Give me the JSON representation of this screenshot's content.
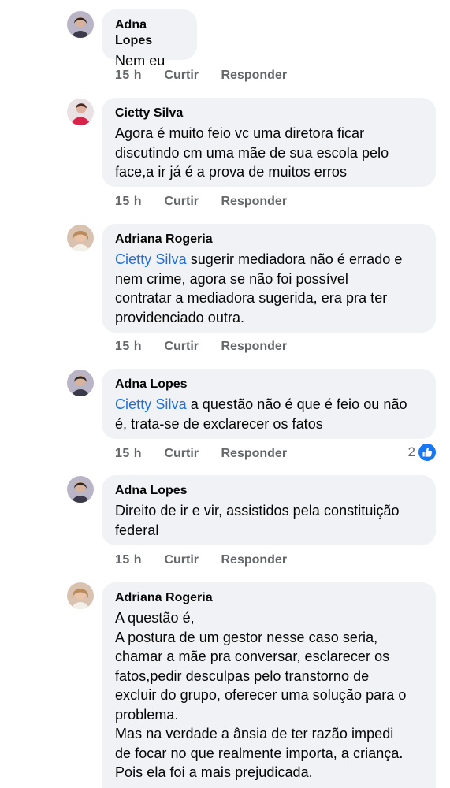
{
  "comments": [
    {
      "author": "Adna Lopes",
      "lines": [
        "Nem eu"
      ],
      "time": "15 h",
      "like_label": "Curtir",
      "reply_label": "Responder"
    },
    {
      "author": "Cietty Silva",
      "lines": [
        "Agora é muito feio vc uma diretora ficar",
        "discutindo cm uma mãe de sua escola pelo",
        "face,a ir já é a prova de muitos erros"
      ],
      "time": "15 h",
      "like_label": "Curtir",
      "reply_label": "Responder"
    },
    {
      "author": "Adriana Rogeria",
      "mention": "Cietty Silva",
      "lines": [
        " sugerir mediadora não é errado e",
        "nem crime, agora se não foi possível",
        "contratar a mediadora sugerida, era pra ter",
        "providenciado outra."
      ],
      "time": "15 h",
      "like_label": "Curtir",
      "reply_label": "Responder"
    },
    {
      "author": "Adna Lopes",
      "mention": "Cietty Silva",
      "lines": [
        " a questão não é que é feio ou não",
        "é, trata-se de exclarecer os fatos"
      ],
      "time": "15 h",
      "like_label": "Curtir",
      "reply_label": "Responder",
      "reaction_count": "2"
    },
    {
      "author": "Adna Lopes",
      "lines": [
        "Direito de ir e vir, assistidos pela constituição",
        "federal"
      ],
      "time": "15 h",
      "like_label": "Curtir",
      "reply_label": "Responder"
    },
    {
      "author": "Adriana Rogeria",
      "lines": [
        "A questão é,",
        "A postura de um gestor nesse caso seria,",
        "chamar a mãe pra conversar, esclarecer os",
        "fatos,pedir desculpas pelo transtorno de",
        "excluir do grupo, oferecer uma solução para o",
        "problema.",
        "Mas na verdade a ânsia de ter razão impedi",
        "de focar no que realmente importa, a criança.",
        "Pois ela foi a mais prejudicada."
      ]
    }
  ],
  "colors": {
    "bubble": "#f0f2f5",
    "mention": "#216fdb",
    "meta": "#65676b",
    "like_blue": "#1877f2"
  },
  "icons": {
    "like": "thumbs-up-like-icon"
  }
}
